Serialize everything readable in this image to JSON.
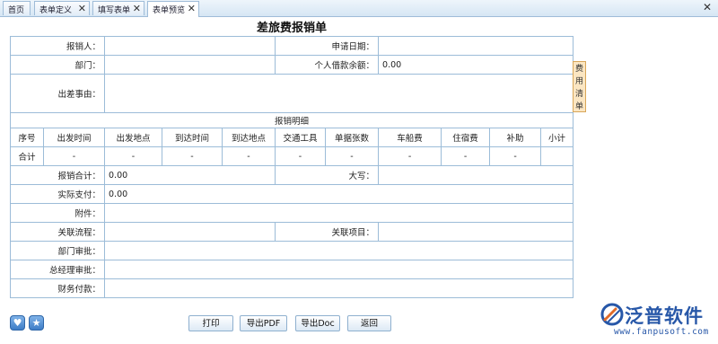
{
  "tabs": [
    {
      "label": "首页"
    },
    {
      "label": "表单定义"
    },
    {
      "label": "填写表单"
    },
    {
      "label": "表单预览"
    }
  ],
  "form": {
    "title": "差旅费报销单",
    "reimburser_label": "报销人：",
    "apply_date_label": "申请日期：",
    "dept_label": "部门：",
    "loan_balance_label": "个人借款余额：",
    "loan_balance_value": "0.00",
    "reason_label": "出差事由：",
    "detail_title": "报销明细",
    "columns": [
      "序号",
      "出发时间",
      "出发地点",
      "到达时间",
      "到达地点",
      "交通工具",
      "单据张数",
      "车船费",
      "住宿费",
      "补助",
      "小计"
    ],
    "total_row": [
      "合计",
      "-",
      "-",
      "-",
      "-",
      "-",
      "-",
      "-",
      "-",
      "-",
      ""
    ],
    "sum_label": "报销合计：",
    "sum_value": "0.00",
    "upper_label": "大写：",
    "actual_label": "实际支付：",
    "actual_value": "0.00",
    "attach_label": "附件：",
    "flow_label": "关联流程：",
    "project_label": "关联项目：",
    "dept_approve_label": "部门审批：",
    "gm_approve_label": "总经理审批：",
    "finance_label": "财务付款：",
    "side_tag": [
      "费",
      "用",
      "清",
      "单"
    ]
  },
  "buttons": {
    "print": "打印",
    "export_pdf": "导出PDF",
    "export_doc": "导出Doc",
    "back": "返回"
  },
  "logo": {
    "name": "泛普软件",
    "url": "www.fanpusoft.com"
  }
}
